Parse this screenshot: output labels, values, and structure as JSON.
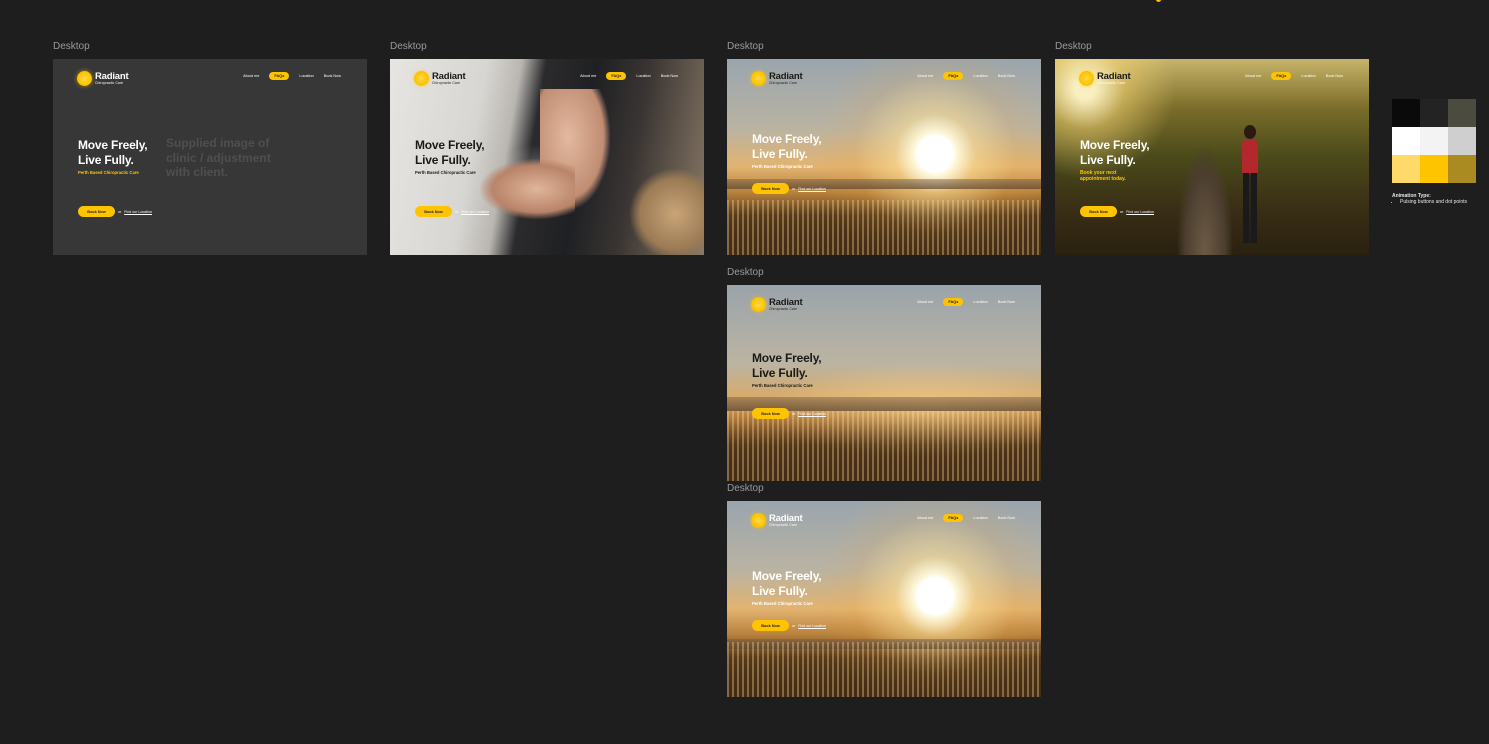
{
  "frames": [
    {
      "label": "Desktop",
      "variant": "dark",
      "nav": {
        "about": "About me",
        "faqs": "FAQs",
        "location": "Location",
        "book": "Book Now"
      },
      "brand": {
        "name": "Radiant",
        "tagline": "Chiropractic Care"
      },
      "hero": {
        "line1": "Move Freely,",
        "line2": "Live Fully.",
        "sub": "Perth Based Chiropractic Care"
      },
      "placeholder": [
        "Supplied image of",
        "clinic / adjustment",
        "with client."
      ],
      "cta": {
        "button": "Book Now",
        "or": "or",
        "link": "Find our Location"
      }
    },
    {
      "label": "Desktop",
      "variant": "adjustment-photo",
      "nav": {
        "about": "About me",
        "faqs": "FAQs",
        "location": "Location",
        "book": "Book Now"
      },
      "brand": {
        "name": "Radiant",
        "tagline": "Chiropractic Care"
      },
      "hero": {
        "line1": "Move Freely,",
        "line2": "Live Fully.",
        "sub": "Perth Based Chiropractic Care"
      },
      "cta": {
        "button": "Book Now",
        "or": "or",
        "link": "Find our Location"
      }
    },
    {
      "label": "Desktop",
      "variant": "sunset",
      "nav": {
        "about": "About me",
        "faqs": "FAQs",
        "location": "Location",
        "book": "Book Now"
      },
      "brand": {
        "name": "Radiant",
        "tagline": "Chiropractic Care"
      },
      "hero": {
        "line1": "Move Freely,",
        "line2": "Live Fully.",
        "sub": "Perth Based Chiropractic Care"
      },
      "cta": {
        "button": "Book Now",
        "or": "or",
        "link": "Find our Location"
      }
    },
    {
      "label": "Desktop",
      "variant": "forest-runner",
      "nav": {
        "about": "About me",
        "faqs": "FAQs",
        "location": "Location",
        "book": "Book Now"
      },
      "brand": {
        "name": "Radiant",
        "tagline": "Chiropractic Care"
      },
      "hero": {
        "line1": "Move Freely,",
        "line2": "Live Fully.",
        "sub": "Book your next appointment today."
      },
      "cta": {
        "button": "Book Now",
        "or": "or",
        "link": "Find our Location"
      }
    },
    {
      "label": "Desktop",
      "variant": "sunset-hills",
      "nav": {
        "about": "About me",
        "faqs": "FAQs",
        "location": "Location",
        "book": "Book Now"
      },
      "brand": {
        "name": "Radiant",
        "tagline": "Chiropractic Care"
      },
      "hero": {
        "line1": "Move Freely,",
        "line2": "Live Fully.",
        "sub": "Perth Based Chiropractic Care"
      },
      "cta": {
        "button": "Book Now",
        "or": "or",
        "link": "Find our Location"
      }
    },
    {
      "label": "Desktop",
      "variant": "sunset-bright",
      "nav": {
        "about": "About me",
        "faqs": "FAQs",
        "location": "Location",
        "book": "Book Now"
      },
      "brand": {
        "name": "Radiant",
        "tagline": "Chiropractic Care"
      },
      "hero": {
        "line1": "Move Freely,",
        "line2": "Live Fully.",
        "sub": "Perth Based Chiropractic Care"
      },
      "cta": {
        "button": "Book Now",
        "or": "or",
        "link": "Find our Location"
      }
    }
  ],
  "palette": [
    "#0a0a0a",
    "#232323",
    "#4b4b40",
    "#ffffff",
    "#f3f3f3",
    "#cfcfcf",
    "#ffd96a",
    "#ffc400",
    "#a98b22"
  ],
  "animation": {
    "title": "Animation Type:",
    "items": [
      "Pulsing buttons and dot points"
    ]
  },
  "accent": "#ffc400"
}
